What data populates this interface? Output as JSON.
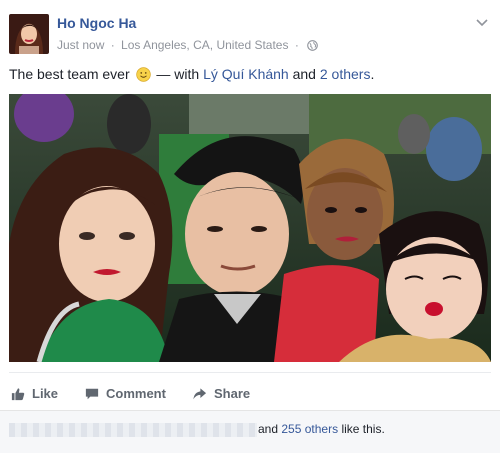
{
  "post": {
    "author": "Ho Ngoc Ha",
    "time": "Just now",
    "separator": "·",
    "location": "Los Angeles, CA, United States",
    "privacy_icon": "globe-icon",
    "text_before": "The best team ever",
    "text_with": "— with",
    "tagged_name": "Lý Quí Khánh",
    "text_and": "and",
    "tagged_others": "2 others",
    "text_end": "."
  },
  "actions": {
    "like_label": "Like",
    "comment_label": "Comment",
    "share_label": "Share"
  },
  "likes": {
    "and_text": "and",
    "others_link": "255 others",
    "suffix": "like this."
  },
  "colors": {
    "link": "#365899",
    "meta": "#90949c",
    "action": "#606770",
    "likes_bg": "#f6f7f9"
  }
}
